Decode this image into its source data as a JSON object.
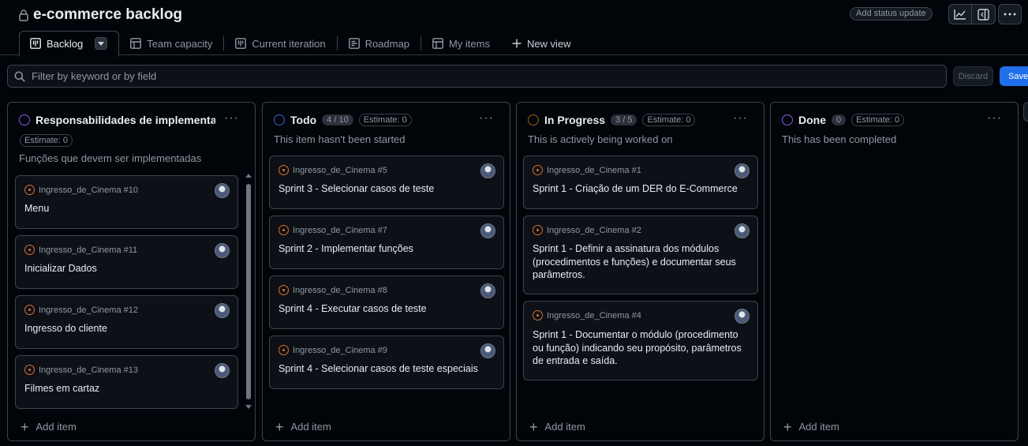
{
  "project": {
    "title": "e-commerce backlog",
    "lock_icon": "lock-icon",
    "add_status_label": "Add status update"
  },
  "header_icons": [
    "insights-icon",
    "side-panel-icon",
    "kebab-horizontal-icon"
  ],
  "tabs": [
    {
      "label": "Backlog",
      "icon": "board-icon",
      "active": true
    },
    {
      "label": "Team capacity",
      "icon": "table-icon"
    },
    {
      "label": "Current iteration",
      "icon": "board-icon"
    },
    {
      "label": "Roadmap",
      "icon": "roadmap-icon"
    },
    {
      "label": "My items",
      "icon": "table-icon"
    },
    {
      "label": "New view",
      "icon": "plus-icon"
    }
  ],
  "filter": {
    "placeholder": "Filter by keyword or by field",
    "discard_label": "Discard",
    "save_label": "Save"
  },
  "columns": [
    {
      "name": "Responsabilidades de implementaç",
      "dot_color": "#8957e5",
      "count": "",
      "estimate": "Estimate: 0",
      "description": "Funções que devem ser implementadas",
      "add_label": "Add item",
      "cards": [
        {
          "repo": "Ingresso_de_Cinema #10",
          "title": "Menu"
        },
        {
          "repo": "Ingresso_de_Cinema #11",
          "title": "Inicializar Dados"
        },
        {
          "repo": "Ingresso_de_Cinema #12",
          "title": "Ingresso do cliente"
        },
        {
          "repo": "Ingresso_de_Cinema #13",
          "title": "Filmes em cartaz"
        }
      ]
    },
    {
      "name": "Todo",
      "dot_color": "#316dca",
      "count": "4 / 10",
      "estimate": "Estimate: 0",
      "description": "This item hasn't been started",
      "add_label": "Add item",
      "cards": [
        {
          "repo": "Ingresso_de_Cinema #5",
          "title": "Sprint 3 - Selecionar casos de teste"
        },
        {
          "repo": "Ingresso_de_Cinema #7",
          "title": "Sprint 2 - Implementar funções"
        },
        {
          "repo": "Ingresso_de_Cinema #8",
          "title": "Sprint 4 - Executar casos de teste"
        },
        {
          "repo": "Ingresso_de_Cinema #9",
          "title": "Sprint 4 - Selecionar casos de teste especiais"
        }
      ]
    },
    {
      "name": "In Progress",
      "dot_color": "#9e6a03",
      "count": "3 / 5",
      "estimate": "Estimate: 0",
      "description": "This is actively being worked on",
      "add_label": "Add item",
      "cards": [
        {
          "repo": "Ingresso_de_Cinema #1",
          "title": "Sprint 1 - Criação de um DER do E-Commerce"
        },
        {
          "repo": "Ingresso_de_Cinema #2",
          "title": "Sprint 1 - Definir a assinatura dos módulos (procedimentos e funções) e documentar seus parâmetros."
        },
        {
          "repo": "Ingresso_de_Cinema #4",
          "title": "Sprint 1 - Documentar o módulo (procedimento ou função) indicando seu propósito, parâmetros de entrada e saída."
        }
      ]
    },
    {
      "name": "Done",
      "dot_color": "#8957e5",
      "count": "0",
      "estimate": "Estimate: 0",
      "description": "This has been completed",
      "add_label": "Add item",
      "cards": []
    }
  ]
}
